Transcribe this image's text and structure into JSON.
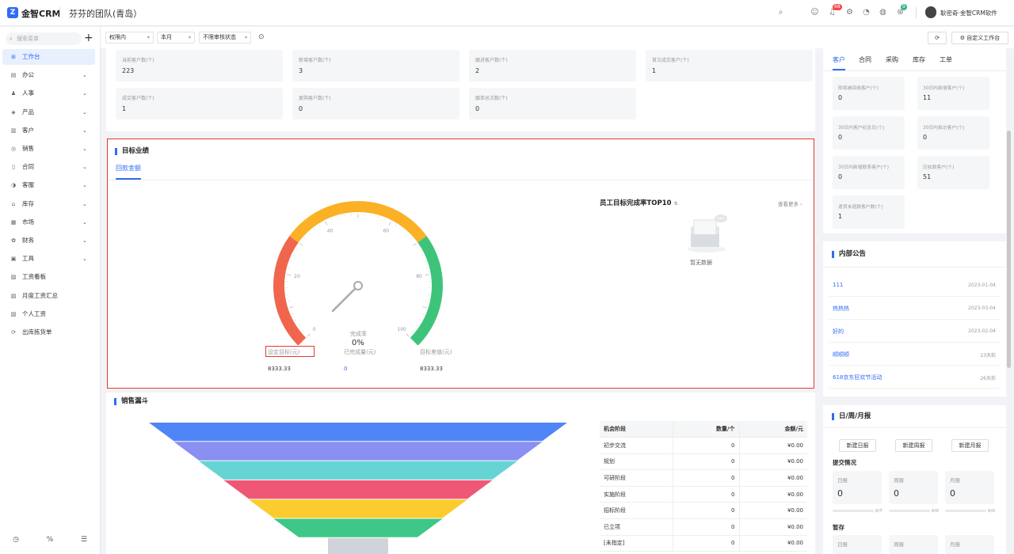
{
  "app": {
    "logo_glyph": "Z",
    "brand": "金智CRM",
    "team": "芬芬的团队(青岛）"
  },
  "topbar": {
    "badge_1": "68",
    "badge_2": "9",
    "user": "耿密奇·金智CRM软件"
  },
  "sidebar": {
    "search_placeholder": "搜索菜单",
    "items": [
      {
        "label": "工作台",
        "icon": "grid-icon",
        "glyph": "⊞",
        "chev": false,
        "active": true
      },
      {
        "label": "办公",
        "icon": "briefcase-icon",
        "glyph": "▤",
        "chev": true
      },
      {
        "label": "人事",
        "icon": "user-icon",
        "glyph": "♟",
        "chev": true
      },
      {
        "label": "产品",
        "icon": "box-icon",
        "glyph": "◈",
        "chev": true
      },
      {
        "label": "客户",
        "icon": "chart-icon",
        "glyph": "▥",
        "chev": true
      },
      {
        "label": "销售",
        "icon": "target-icon",
        "glyph": "◎",
        "chev": true
      },
      {
        "label": "合同",
        "icon": "document-icon",
        "glyph": "▯",
        "chev": true
      },
      {
        "label": "客服",
        "icon": "headset-icon",
        "glyph": "◑",
        "chev": true
      },
      {
        "label": "库存",
        "icon": "warehouse-icon",
        "glyph": "⌂",
        "chev": true
      },
      {
        "label": "市场",
        "icon": "calendar-icon",
        "glyph": "▦",
        "chev": true
      },
      {
        "label": "财务",
        "icon": "finance-icon",
        "glyph": "✿",
        "chev": true
      },
      {
        "label": "工具",
        "icon": "tool-icon",
        "glyph": "▣",
        "chev": true
      },
      {
        "label": "工资看板",
        "icon": "report-icon",
        "glyph": "▧",
        "chev": false
      },
      {
        "label": "月度工资汇总",
        "icon": "report-icon",
        "glyph": "▧",
        "chev": false
      },
      {
        "label": "个人工资",
        "icon": "report-icon",
        "glyph": "▧",
        "chev": false
      },
      {
        "label": "出库拣货单",
        "icon": "link-icon",
        "glyph": "⟳",
        "chev": false
      }
    ]
  },
  "filters": {
    "scope": "权限内",
    "period": "本月",
    "audit": "不限审核状态",
    "customize": "自定义工作台"
  },
  "stats": [
    {
      "label": "当前客户数(个)",
      "value": "223"
    },
    {
      "label": "新增客户数(个)",
      "value": "3"
    },
    {
      "label": "跟进客户数(个)",
      "value": "2"
    },
    {
      "label": "首次成交客户(个)",
      "value": "1"
    },
    {
      "label": "成交客户数(个)",
      "value": "1"
    },
    {
      "label": "复购客户数(个)",
      "value": "0"
    },
    {
      "label": "跟单总次数(个)",
      "value": "0"
    }
  ],
  "target": {
    "title": "目标业绩",
    "tab": "回款金额",
    "gauge_ticks": [
      "0",
      "20",
      "40",
      "60",
      "80",
      "100"
    ],
    "rate_label": "完成率",
    "rate_value": "0%",
    "rate": 0,
    "metrics": [
      {
        "label": "设定目标(元)",
        "value": "8333.33"
      },
      {
        "label": "已完成量(元)",
        "value": "0"
      },
      {
        "label": "目标差值(元)",
        "value": "8333.33"
      }
    ],
    "top10_title": "员工目标完成率TOP10",
    "more": "查看更多 ›",
    "nodata": "暂无数据"
  },
  "funnel": {
    "title": "销售漏斗",
    "colors": [
      "#4f85f6",
      "#8a8ff2",
      "#66d4d4",
      "#ef5777",
      "#fccb2e",
      "#3ec787",
      "#d0d3da"
    ],
    "headers": [
      "机会阶段",
      "数量/个",
      "金额/元"
    ],
    "rows": [
      [
        "初步交流",
        "0",
        "¥0.00"
      ],
      [
        "规划",
        "0",
        "¥0.00"
      ],
      [
        "可研阶段",
        "0",
        "¥0.00"
      ],
      [
        "实施阶段",
        "0",
        "¥0.00"
      ],
      [
        "招标阶段",
        "0",
        "¥0.00"
      ],
      [
        "已立项",
        "0",
        "¥0.00"
      ],
      [
        "[未指定]",
        "0",
        "¥0.00"
      ]
    ]
  },
  "right": {
    "tabs": [
      "客户",
      "合同",
      "采购",
      "库存",
      "工单"
    ],
    "stats": [
      {
        "label": "即将被回收客户(个)",
        "value": "0"
      },
      {
        "label": "30日内新增客户(个)",
        "value": "11"
      },
      {
        "label": "30日内客户纪念日(个)",
        "value": "0"
      },
      {
        "label": "30日内拟访客户(个)",
        "value": "0"
      },
      {
        "label": "30日内新增联系客户(个)",
        "value": "0"
      },
      {
        "label": "应收款客户(个)",
        "value": "51"
      },
      {
        "label": "退货未退款客户数(个)",
        "value": "1"
      }
    ],
    "notice_title": "内部公告",
    "notices": [
      {
        "title": "111",
        "date": "2023-01-04"
      },
      {
        "title": "热热热",
        "date": "2023-03-04"
      },
      {
        "title": "好的",
        "date": "2023-02-04"
      },
      {
        "title": "顺顺顺",
        "date": "23天前"
      },
      {
        "title": "618京东狂欢节活动",
        "date": "26天前"
      }
    ],
    "report_title": "日/周/月报",
    "report_buttons": [
      "新建日报",
      "新建周报",
      "新建月报"
    ],
    "submit_title": "提交情况",
    "reports": [
      {
        "label": "日报",
        "value": "0",
        "progress": "0/7"
      },
      {
        "label": "周报",
        "value": "0",
        "progress": "0/0"
      },
      {
        "label": "月报",
        "value": "0",
        "progress": "0/0"
      }
    ],
    "draft_title": "暂存",
    "drafts": [
      "日报",
      "周报",
      "月报"
    ]
  }
}
